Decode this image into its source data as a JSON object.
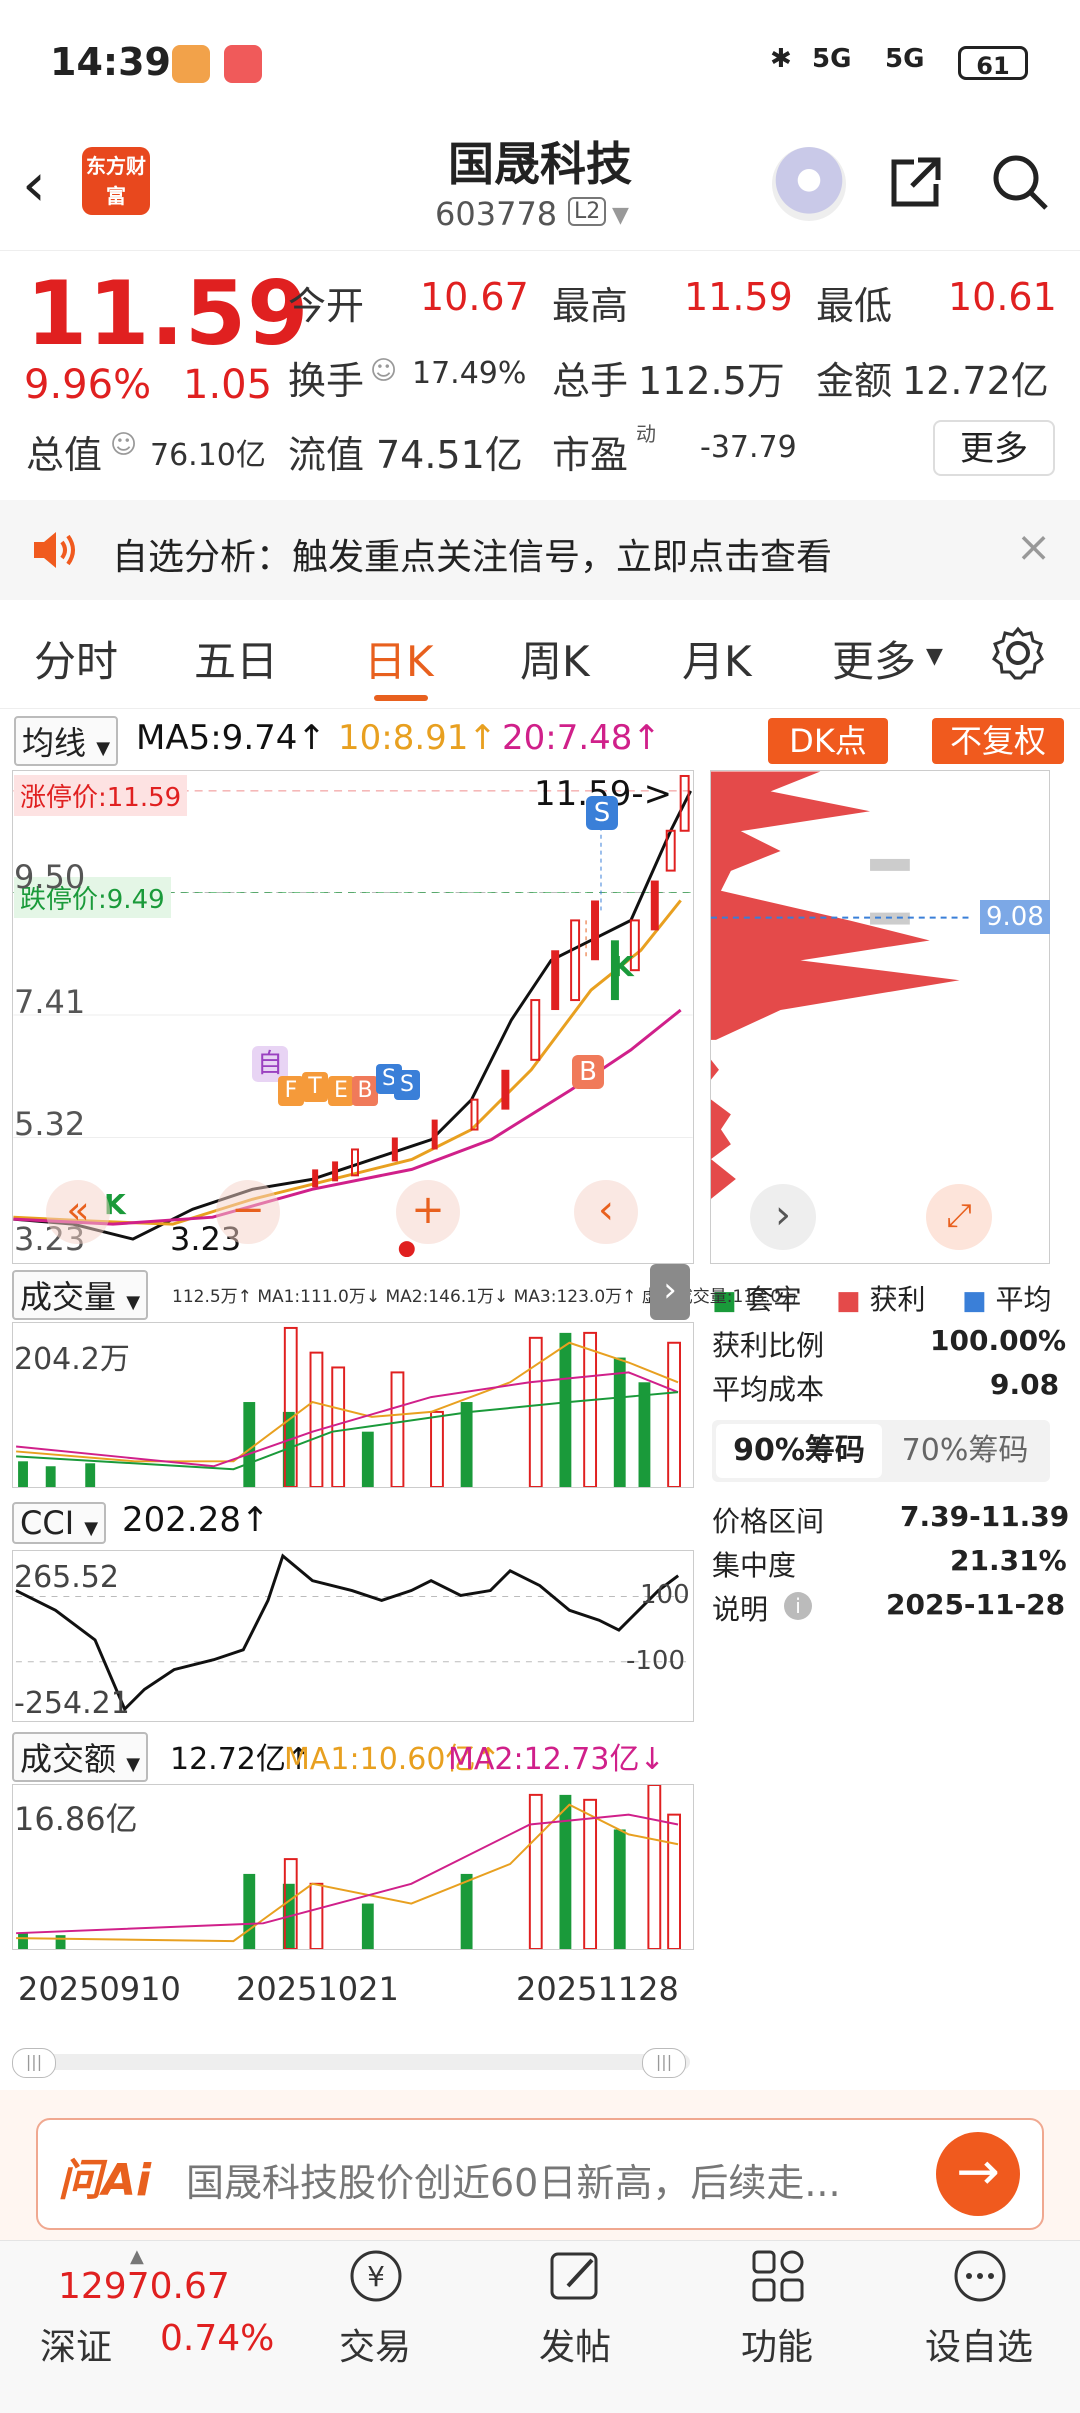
{
  "status": {
    "time": "14:39",
    "signal1": "5G",
    "signal2": "5G",
    "battery": "61"
  },
  "header": {
    "logo_text": "东方财富",
    "name": "国晟科技",
    "code": "603778",
    "l2": "L2"
  },
  "quote": {
    "price": "11.59",
    "pct": "9.96%",
    "change": "1.05",
    "open_label": "今开",
    "open": "10.67",
    "high_label": "最高",
    "high": "11.59",
    "low_label": "最低",
    "low": "10.61",
    "turnover_label": "换手",
    "turnover": "17.49%",
    "volume_label": "总手",
    "volume": "112.5万",
    "amount_label": "金额",
    "amount": "12.72亿",
    "mcap_label": "总值",
    "mcap": "76.10亿",
    "float_label": "流值",
    "float": "74.51亿",
    "pe_label": "市盈",
    "pe_sup": "动",
    "pe": "-37.79",
    "more": "更多"
  },
  "banner": {
    "text": "自选分析：触发重点关注信号，立即点击查看",
    "close": "×"
  },
  "tabs": [
    {
      "label": "分时"
    },
    {
      "label": "五日"
    },
    {
      "label": "日K"
    },
    {
      "label": "周K"
    },
    {
      "label": "月K"
    },
    {
      "label": "更多"
    }
  ],
  "ma_bar": {
    "selector": "均线",
    "ma5": "MA5:9.74↑",
    "ma10": "10:8.91↑",
    "ma20": "20:7.48↑",
    "dk": "DK点",
    "fq": "不复权"
  },
  "kchart": {
    "limit_up": "涨停价:11.59",
    "limit_down": "跌停价:9.49",
    "price_max_note": "11.59->",
    "min_note": "3.23",
    "y_labels": [
      "9.50",
      "7.41",
      "5.32",
      "3.23"
    ],
    "marker_zi": "自",
    "marker_s": "S",
    "marker_b": "B",
    "marker_k": "K",
    "marker_f": "F",
    "marker_t": "T",
    "marker_e": "E",
    "chip_price_tag": "9.08"
  },
  "volume_panel": {
    "selector": "成交量",
    "legend": "112.5万↑ MA1:111.0万↓ MA2:146.1万↓ MA3:123.0万↑ 虚拟成交量:113.0万",
    "ymax": "204.2万"
  },
  "cci_panel": {
    "selector": "CCI",
    "value": "202.28↑",
    "ymax": "265.52",
    "ymin": "-254.21",
    "line100": "100",
    "line_neg100": "-100"
  },
  "amount_panel": {
    "selector": "成交额",
    "value": "12.72亿↑",
    "ma1": "MA1:10.60亿↑",
    "ma2": "MA2:12.73亿↓",
    "ymax": "16.86亿",
    "dates": [
      "20250910",
      "20251021",
      "20251128"
    ]
  },
  "chips": {
    "legend": [
      "套牢",
      "获利",
      "平均"
    ],
    "profit_ratio_label": "获利比例",
    "profit_ratio": "100.00%",
    "avg_cost_label": "平均成本",
    "avg_cost": "9.08",
    "tab90": "90%筹码",
    "tab70": "70%筹码",
    "range_label": "价格区间",
    "range": "7.39-11.39",
    "conc_label": "集中度",
    "conc": "21.31%",
    "note_label": "说明",
    "note": "2025-11-28"
  },
  "ai": {
    "logo": "问Ai",
    "text": "国晟科技股价创近60日新高，后续走..."
  },
  "index": {
    "value": "12970.67",
    "name": "深证",
    "pct": "0.74%"
  },
  "nav": [
    {
      "label": "交易",
      "icon": "trade-icon"
    },
    {
      "label": "发帖",
      "icon": "post-icon"
    },
    {
      "label": "功能",
      "icon": "apps-icon"
    },
    {
      "label": "设自选",
      "icon": "more-icon"
    }
  ],
  "colors": {
    "up": "#e02020",
    "down": "#1a9a3a",
    "accent": "#f05a1e",
    "ma5": "#111111",
    "ma10": "#e8a020",
    "ma20": "#d0208a"
  }
}
